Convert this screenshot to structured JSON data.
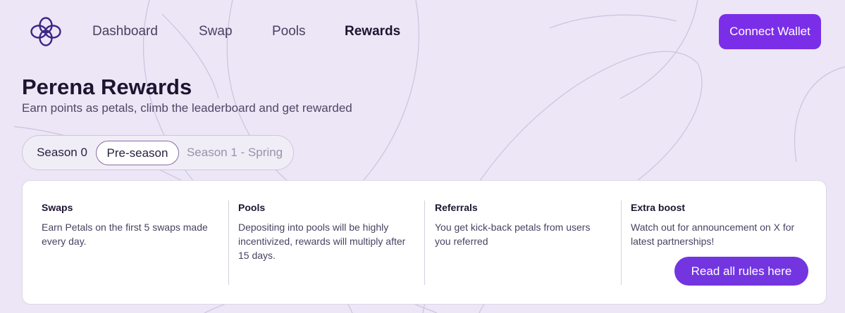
{
  "nav": {
    "items": [
      {
        "label": "Dashboard",
        "active": false
      },
      {
        "label": "Swap",
        "active": false
      },
      {
        "label": "Pools",
        "active": false
      },
      {
        "label": "Rewards",
        "active": true
      }
    ],
    "logo_icon": "flower-logo-icon"
  },
  "header": {
    "connect_label": "Connect Wallet"
  },
  "page": {
    "title": "Perena Rewards",
    "subtitle": "Earn points as petals, climb the leaderboard and get rewarded"
  },
  "seasons": {
    "tabs": [
      {
        "label": "Season 0",
        "state": "default"
      },
      {
        "label": "Pre-season",
        "state": "selected"
      },
      {
        "label": "Season 1 - Spring",
        "state": "disabled"
      }
    ]
  },
  "rules": {
    "columns": [
      {
        "title": "Swaps",
        "text": "Earn Petals on the first 5 swaps made every day."
      },
      {
        "title": "Pools",
        "text": "Depositing into pools will be highly incentivized, rewards will multiply after 15 days."
      },
      {
        "title": "Referrals",
        "text": "You get kick-back petals from users you referred"
      },
      {
        "title": "Extra boost",
        "text": "Watch out for announcement on X for latest partnerships!"
      }
    ],
    "button_label": "Read all rules here"
  },
  "colors": {
    "background": "#ece6f6",
    "accent": "#7b2ee8",
    "accent_secondary": "#7335e0",
    "text_primary": "#1d1530"
  }
}
